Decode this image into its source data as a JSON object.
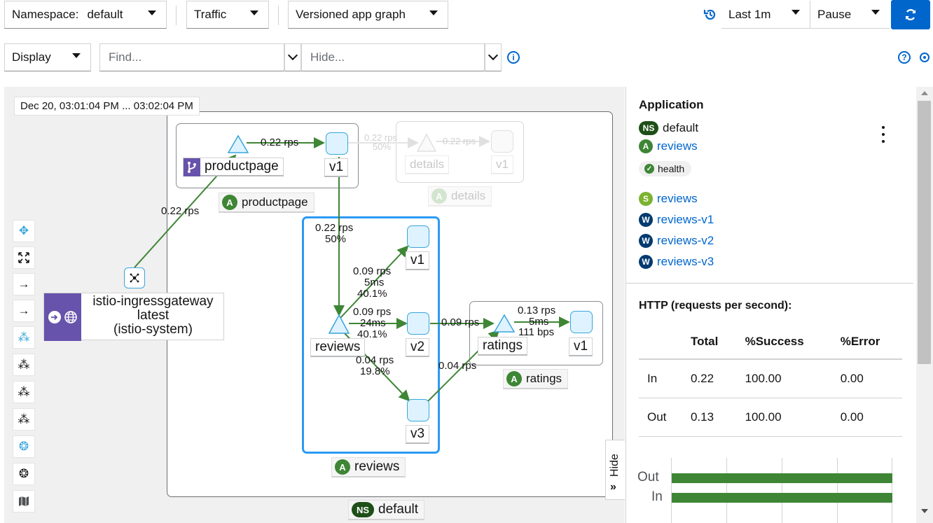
{
  "toolbar": {
    "namespace_label": "Namespace:",
    "namespace_value": "default",
    "traffic_label": "Traffic",
    "graph_type": "Versioned app graph",
    "duration": "Last 1m",
    "refresh": "Pause",
    "display_label": "Display",
    "find_placeholder": "Find...",
    "hide_placeholder": "Hide..."
  },
  "graph": {
    "timestamp": "Dec 20, 03:01:04 PM ... 03:02:04 PM",
    "namespace_box": "default",
    "namespace_badge": "NS",
    "app_badge": "A",
    "apps": {
      "productpage": "productpage",
      "details": "details",
      "reviews": "reviews",
      "ratings": "ratings"
    },
    "nodes": {
      "productpage_svc": "productpage",
      "productpage_v1": "v1",
      "details_svc": "details",
      "details_v1": "v1",
      "reviews_svc": "reviews",
      "reviews_v1": "v1",
      "reviews_v2": "v2",
      "reviews_v3": "v3",
      "ratings_svc": "ratings",
      "ratings_v1": "v1",
      "gateway_name": "istio-ingressgateway",
      "gateway_version": "latest",
      "gateway_ns": "(istio-system)"
    },
    "edges": {
      "gateway_to_productpage": "0.22 rps",
      "productpage_internal": "0.22 rps",
      "details_a": "0.22 rps",
      "details_b": "50%",
      "details_internal": "0.22 rps",
      "to_reviews_rps": "0.22 rps",
      "to_reviews_pct": "50%",
      "to_v1_rps": "0.09 rps",
      "to_v1_ms": "5ms",
      "to_v1_pct": "40.1%",
      "to_v2_rps": "0.09 rps",
      "to_v2_ms": "24ms",
      "to_v2_pct": "40.1%",
      "to_v3_rps": "0.04 rps",
      "to_v3_pct": "19.8%",
      "v2_to_ratings": "0.09 rps",
      "v3_to_ratings": "0.04 rps",
      "ratings_rps": "0.13 rps",
      "ratings_ms": "5ms",
      "ratings_bps": "111 bps"
    },
    "hide_label": "Hide"
  },
  "sidebar": {
    "heading": "Application",
    "ns_badge": "NS",
    "namespace": "default",
    "app_badge": "A",
    "app": "reviews",
    "health": "health",
    "service_badge": "S",
    "service": "reviews",
    "workload_badge": "W",
    "workloads": [
      "reviews-v1",
      "reviews-v2",
      "reviews-v3"
    ],
    "http_heading": "HTTP (requests per second):",
    "table_headers": [
      "",
      "Total",
      "%Success",
      "%Error"
    ],
    "table_rows": [
      [
        "In",
        "0.22",
        "100.00",
        "0.00"
      ],
      [
        "Out",
        "0.13",
        "100.00",
        "0.00"
      ]
    ],
    "bar_chart_labels": [
      "Out",
      "In"
    ]
  },
  "colors": {
    "edge_green": "#3e8635",
    "node_blue": "#39a5dc",
    "primary_button": "#0066cc",
    "app_badge": "#3e8635",
    "ns_badge": "#1e4f18",
    "workload_badge": "#003a70",
    "service_badge": "#7bb32e",
    "gateway_purple": "#6753ac"
  }
}
